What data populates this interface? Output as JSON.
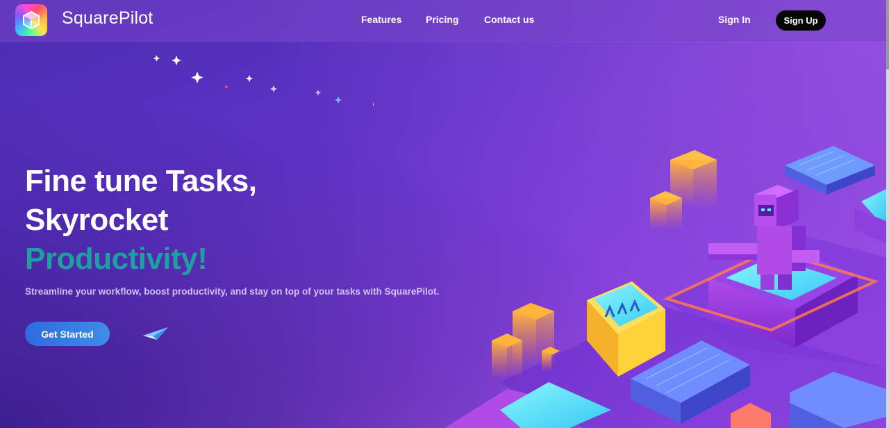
{
  "header": {
    "brand": "SquarePilot",
    "nav": {
      "features": "Features",
      "pricing": "Pricing",
      "contact": "Contact us"
    },
    "sign_in": "Sign In",
    "sign_up": "Sign Up"
  },
  "hero": {
    "title_line1": "Fine tune Tasks,",
    "title_line2": "Skyrocket",
    "title_line3": "Productivity!",
    "subtitle": "Streamline your workflow, boost productivity, and stay on top of your tasks with SquarePilot.",
    "cta": "Get Started"
  },
  "colors": {
    "accent_text": "#1fa0a0",
    "cta_blue": "#3478e4",
    "signup_bg": "#050505",
    "bg_purple": "#6a36cc"
  },
  "icons": {
    "logo": "squarepilot-logo-icon",
    "plane": "paper-plane-icon",
    "illustration": "isometric-robot-city-illustration"
  }
}
